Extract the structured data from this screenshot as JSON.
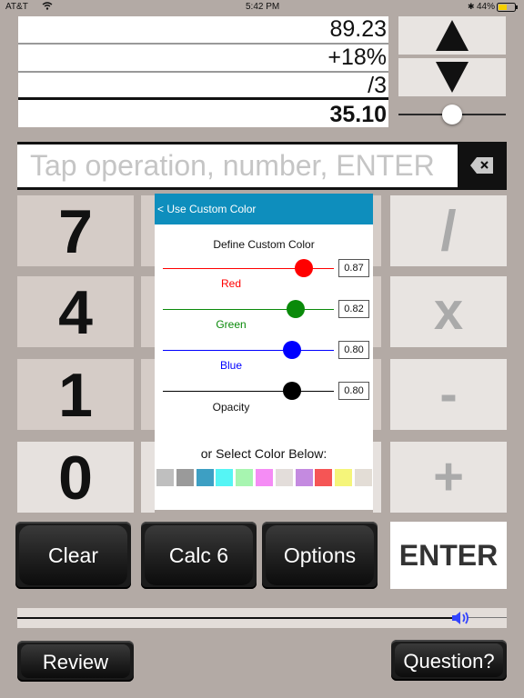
{
  "status_bar": {
    "carrier": "AT&T",
    "time": "5:42 PM",
    "battery": "44%"
  },
  "tape": {
    "lines": [
      "89.23",
      "+18%",
      "/3"
    ],
    "result": "35.10"
  },
  "entry": {
    "placeholder": "Tap operation, number, ENTER"
  },
  "keypad": {
    "digits": [
      "7",
      "4",
      "1",
      "0"
    ],
    "operators": [
      "/",
      "x",
      "-",
      "+"
    ],
    "enter_label": "ENTER"
  },
  "buttons": {
    "clear": "Clear",
    "calc": "Calc 6",
    "options": "Options",
    "review": "Review",
    "question": "Question?"
  },
  "custom_color_dialog": {
    "back_label": "< Use Custom Color",
    "title": "Define Custom Color",
    "sliders": [
      {
        "label": "Red",
        "value": "0.87",
        "color": "#ff0000"
      },
      {
        "label": "Green",
        "value": "0.82",
        "color": "#0a8a0a"
      },
      {
        "label": "Blue",
        "value": "0.80",
        "color": "#0000ff"
      },
      {
        "label": "Opacity",
        "value": "0.80",
        "color": "#000000"
      }
    ],
    "select_label": "or Select Color Below:",
    "swatches": [
      "#bfbfbf",
      "#9a9a9a",
      "#3d9fc3",
      "#55f5f5",
      "#a7f5b0",
      "#f58cf5",
      "#e3ddda",
      "#c48ae0",
      "#f55555",
      "#f5f57a",
      "#e3ddd6"
    ]
  },
  "colors": {
    "background": "#b3aaa5",
    "key": "#d5ccc7",
    "dialog_header": "#0e8ebd",
    "volume_icon": "#3344ff"
  }
}
